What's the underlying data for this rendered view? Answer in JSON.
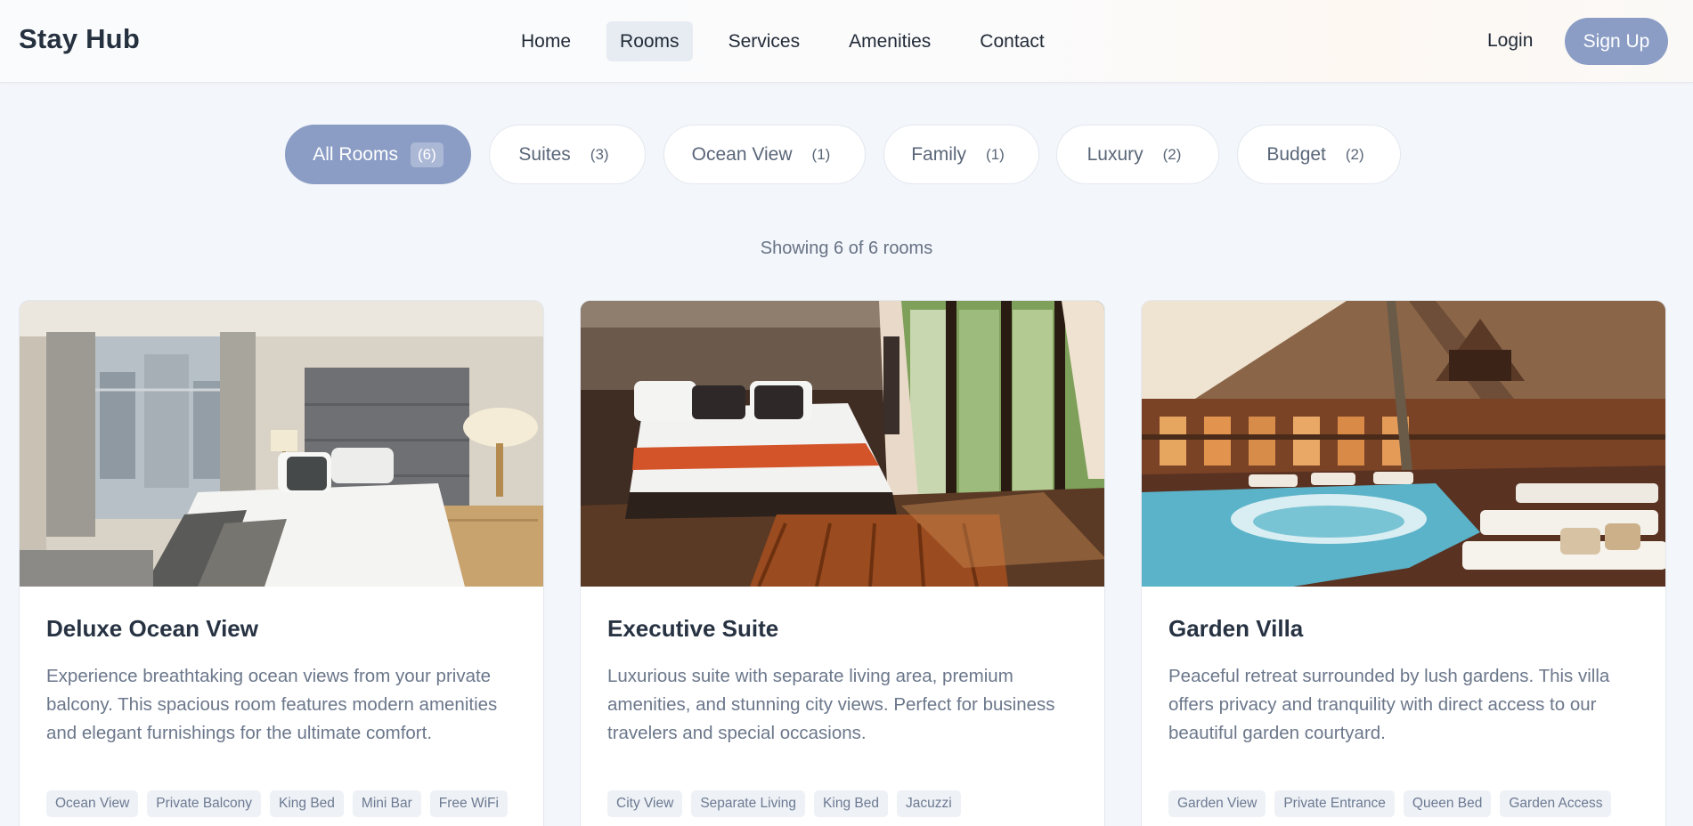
{
  "header": {
    "brand": "Stay Hub",
    "nav": [
      {
        "label": "Home",
        "active": false
      },
      {
        "label": "Rooms",
        "active": true
      },
      {
        "label": "Services",
        "active": false
      },
      {
        "label": "Amenities",
        "active": false
      },
      {
        "label": "Contact",
        "active": false
      }
    ],
    "login_label": "Login",
    "signup_label": "Sign Up"
  },
  "filters": [
    {
      "label": "All Rooms",
      "count": "(6)",
      "active": true
    },
    {
      "label": "Suites",
      "count": "(3)",
      "active": false
    },
    {
      "label": "Ocean View",
      "count": "(1)",
      "active": false
    },
    {
      "label": "Family",
      "count": "(1)",
      "active": false
    },
    {
      "label": "Luxury",
      "count": "(2)",
      "active": false
    },
    {
      "label": "Budget",
      "count": "(2)",
      "active": false
    }
  ],
  "results_text": "Showing 6 of 6 rooms",
  "rooms": [
    {
      "title": "Deluxe Ocean View",
      "description": "Experience breathtaking ocean views from your private balcony. This spacious room features modern amenities and elegant furnishings for the ultimate comfort.",
      "tags": [
        "Ocean View",
        "Private Balcony",
        "King Bed",
        "Mini Bar",
        "Free WiFi"
      ]
    },
    {
      "title": "Executive Suite",
      "description": "Luxurious suite with separate living area, premium amenities, and stunning city views. Perfect for business travelers and special occasions.",
      "tags": [
        "City View",
        "Separate Living",
        "King Bed",
        "Jacuzzi"
      ]
    },
    {
      "title": "Garden Villa",
      "description": "Peaceful retreat surrounded by lush gardens. This villa offers privacy and tranquility with direct access to our beautiful garden courtyard.",
      "tags": [
        "Garden View",
        "Private Entrance",
        "Queen Bed",
        "Garden Access"
      ]
    }
  ],
  "colors": {
    "accent": "#8b9dc5",
    "background": "#f3f6fa",
    "active_nav_bg": "#e7ecf2",
    "title_text": "#273242",
    "muted_text": "#6b778b"
  }
}
